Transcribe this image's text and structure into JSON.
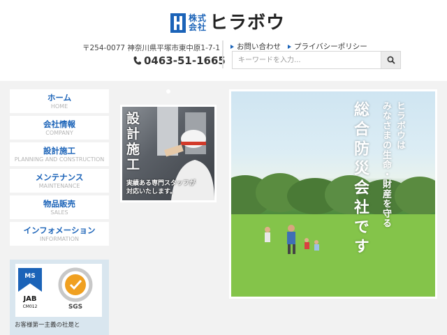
{
  "header": {
    "logo": {
      "company_prefix": "株式会社",
      "company_name": "ヒラボウ"
    },
    "address": "〒254-0077 神奈川県平塚市東中原1-7-1",
    "phone": "0463-51-1665",
    "links": [
      {
        "label": "お問い合わせ"
      },
      {
        "label": "プライバシーポリシー"
      }
    ],
    "search": {
      "placeholder": "キーワードを入力..."
    }
  },
  "nav": {
    "items": [
      {
        "jp": "ホーム",
        "en": "HOME"
      },
      {
        "jp": "会社情報",
        "en": "COMPANY"
      },
      {
        "jp": "設計施工",
        "en": "PLANNING AND CONSTRUCTION"
      },
      {
        "jp": "メンテナンス",
        "en": "MAINTENANCE"
      },
      {
        "jp": "物品販売",
        "en": "SALES"
      },
      {
        "jp": "インフォメーション",
        "en": "INFORMATION"
      }
    ]
  },
  "cert": {
    "ms_label": "MS",
    "jab_label": "JAB",
    "cm_label": "CM012",
    "sgs_label": "SGS",
    "text": "お客様第一主義の社是と"
  },
  "banner": {
    "title": "設計施工",
    "subtitle_1": "実績ある専門スタッフが",
    "subtitle_2": "対応いたします。"
  },
  "hero": {
    "line1": "ヒラボウは",
    "line2": "みなさまの生命・財産を守る",
    "line3": "総合防災会社です"
  },
  "colors": {
    "accent": "#1b63b8",
    "nav_en": "#b4b4b4",
    "bg": "#f2f2f2"
  }
}
